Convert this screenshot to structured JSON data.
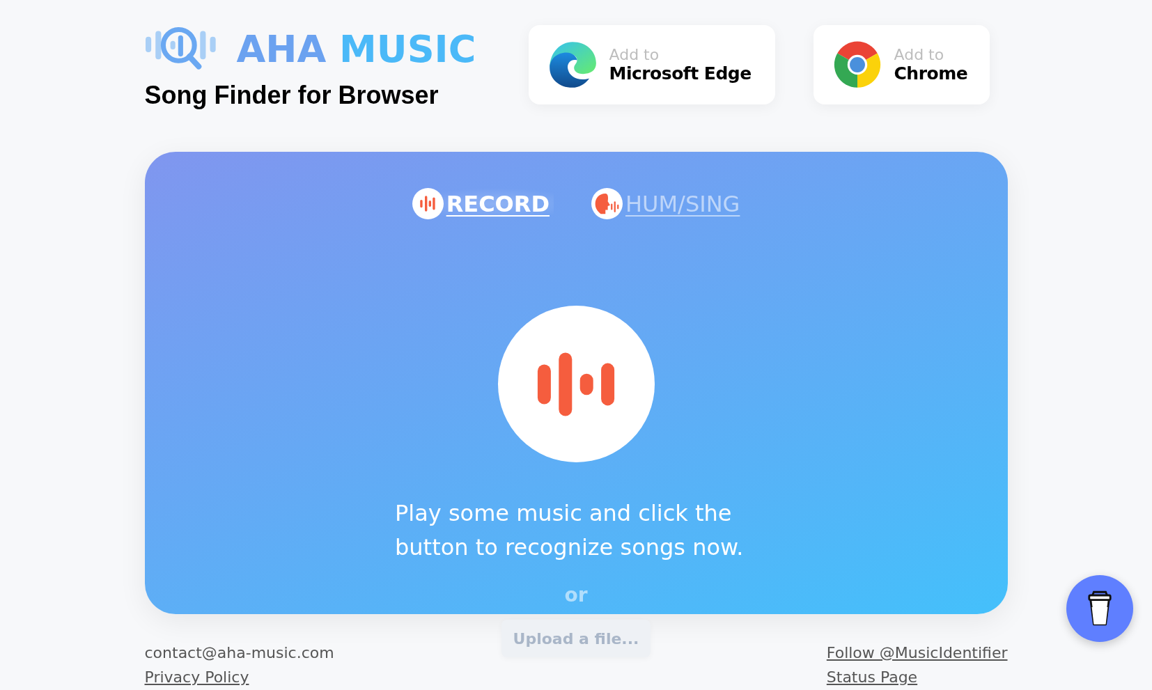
{
  "logo": {
    "first_word": "AHA",
    "second_word": "MUSIC"
  },
  "tagline": "Song Finder for Browser",
  "extensions": [
    {
      "kind": "edge",
      "prefix": "Add to",
      "name": "Microsoft Edge"
    },
    {
      "kind": "chrome",
      "prefix": "Add to",
      "name": "Chrome"
    }
  ],
  "tabs": [
    {
      "kind": "record",
      "label": "RECORD",
      "selected": true
    },
    {
      "kind": "hum",
      "label": "HUM/SING",
      "selected": false
    }
  ],
  "prompt": "Play some music and click the button to recognize songs now.",
  "separator": "or",
  "upload_button": "Upload a file...",
  "footer_left": [
    {
      "kind": "text",
      "label": "contact@aha-music.com"
    },
    {
      "kind": "link",
      "label": "Privacy Policy"
    }
  ],
  "footer_right": [
    {
      "kind": "link",
      "label": "Follow @MusicIdentifier"
    },
    {
      "kind": "link",
      "label": "Status Page"
    }
  ]
}
